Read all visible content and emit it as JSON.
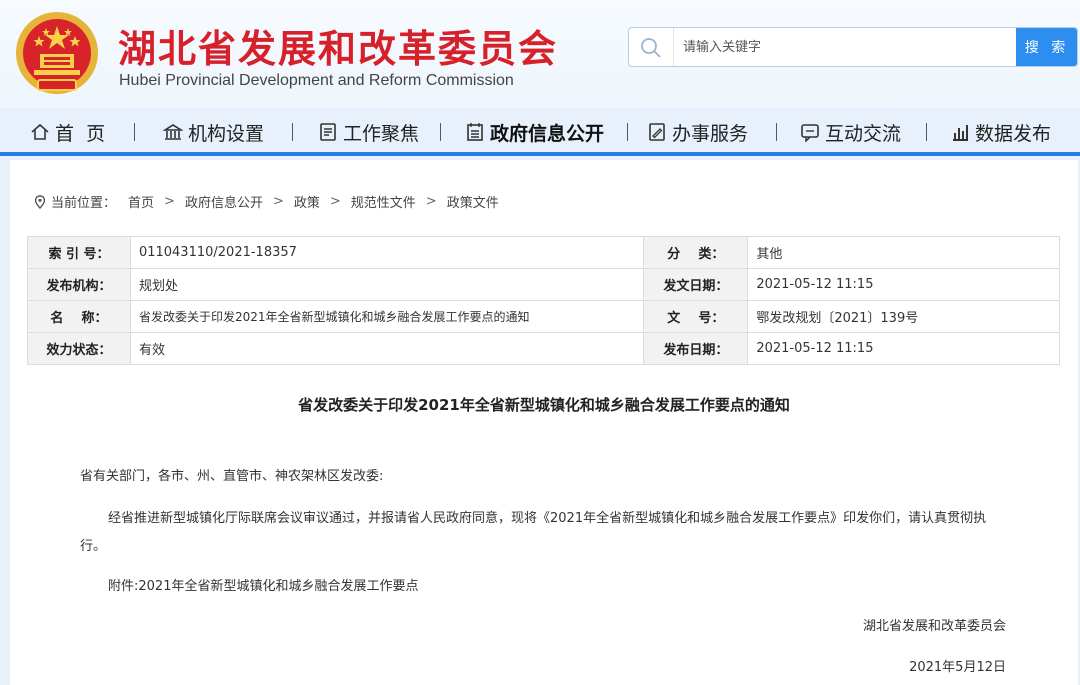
{
  "header": {
    "title": "湖北省发展和改革委员会",
    "subtitle": "Hubei Provincial Development and Reform Commission"
  },
  "search": {
    "placeholder": "请输入关键字",
    "button_label": "搜 索"
  },
  "nav": {
    "items": [
      {
        "label": "首  页",
        "icon": "home-icon"
      },
      {
        "label": "机构设置",
        "icon": "building-icon"
      },
      {
        "label": "工作聚焦",
        "icon": "document-icon"
      },
      {
        "label": "政府信息公开",
        "icon": "list-icon",
        "active": true
      },
      {
        "label": "办事服务",
        "icon": "edit-icon"
      },
      {
        "label": "互动交流",
        "icon": "chat-icon"
      },
      {
        "label": "数据发布",
        "icon": "bar-chart-icon"
      }
    ]
  },
  "breadcrumb": {
    "label": "当前位置：",
    "items": [
      "首页",
      "政府信息公开",
      "政策",
      "规范性文件",
      "政策文件"
    ]
  },
  "meta": {
    "index_label": "索 引 号：",
    "index_value": "011043110/2021-18357",
    "category_label": "分    类：",
    "category_value": "其他",
    "publisher_label": "发布机构：",
    "publisher_value": "规划处",
    "issue_date_label": "发文日期：",
    "issue_date_value": "2021-05-12 11:15",
    "name_label": "名    称：",
    "name_value": "省发改委关于印发2021年全省新型城镇化和城乡融合发展工作要点的通知",
    "doc_no_label": "文    号：",
    "doc_no_value": "鄂发改规划〔2021〕139号",
    "status_label": "效力状态：",
    "status_value": "有效",
    "publish_date_label": "发布日期：",
    "publish_date_value": "2021-05-12 11:15"
  },
  "document": {
    "title": "省发改委关于印发2021年全省新型城镇化和城乡融合发展工作要点的通知",
    "salutation": "省有关部门，各市、州、直管市、神农架林区发改委:",
    "body": "经省推进新型城镇化厅际联席会议审议通过，并报请省人民政府同意，现将《2021年全省新型城镇化和城乡融合发展工作要点》印发你们，请认真贯彻执行。",
    "attachment": "附件:2021年全省新型城镇化和城乡融合发展工作要点",
    "signature": "湖北省发展和改革委员会",
    "date": "2021年5月12日"
  },
  "colors": {
    "brand_red": "#d6202a",
    "accent_blue": "#1f7fe3",
    "search_button": "#2d8ef0"
  }
}
